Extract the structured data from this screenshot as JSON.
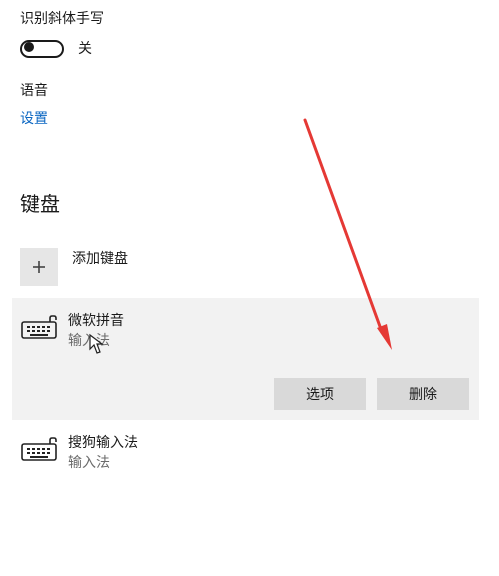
{
  "settings": {
    "handwriting_label": "识别斜体手写",
    "handwriting_state": "关",
    "language_label": "语音",
    "language_link": "设置"
  },
  "keyboard": {
    "section_title": "键盘",
    "add_keyboard_label": "添加键盘",
    "items": [
      {
        "title": "微软拼音",
        "subtitle": "输入法",
        "actions": [
          "选项",
          "删除"
        ]
      },
      {
        "title": "搜狗输入法",
        "subtitle": "输入法"
      }
    ]
  },
  "annotation": {
    "arrow_color": "#e53935"
  }
}
